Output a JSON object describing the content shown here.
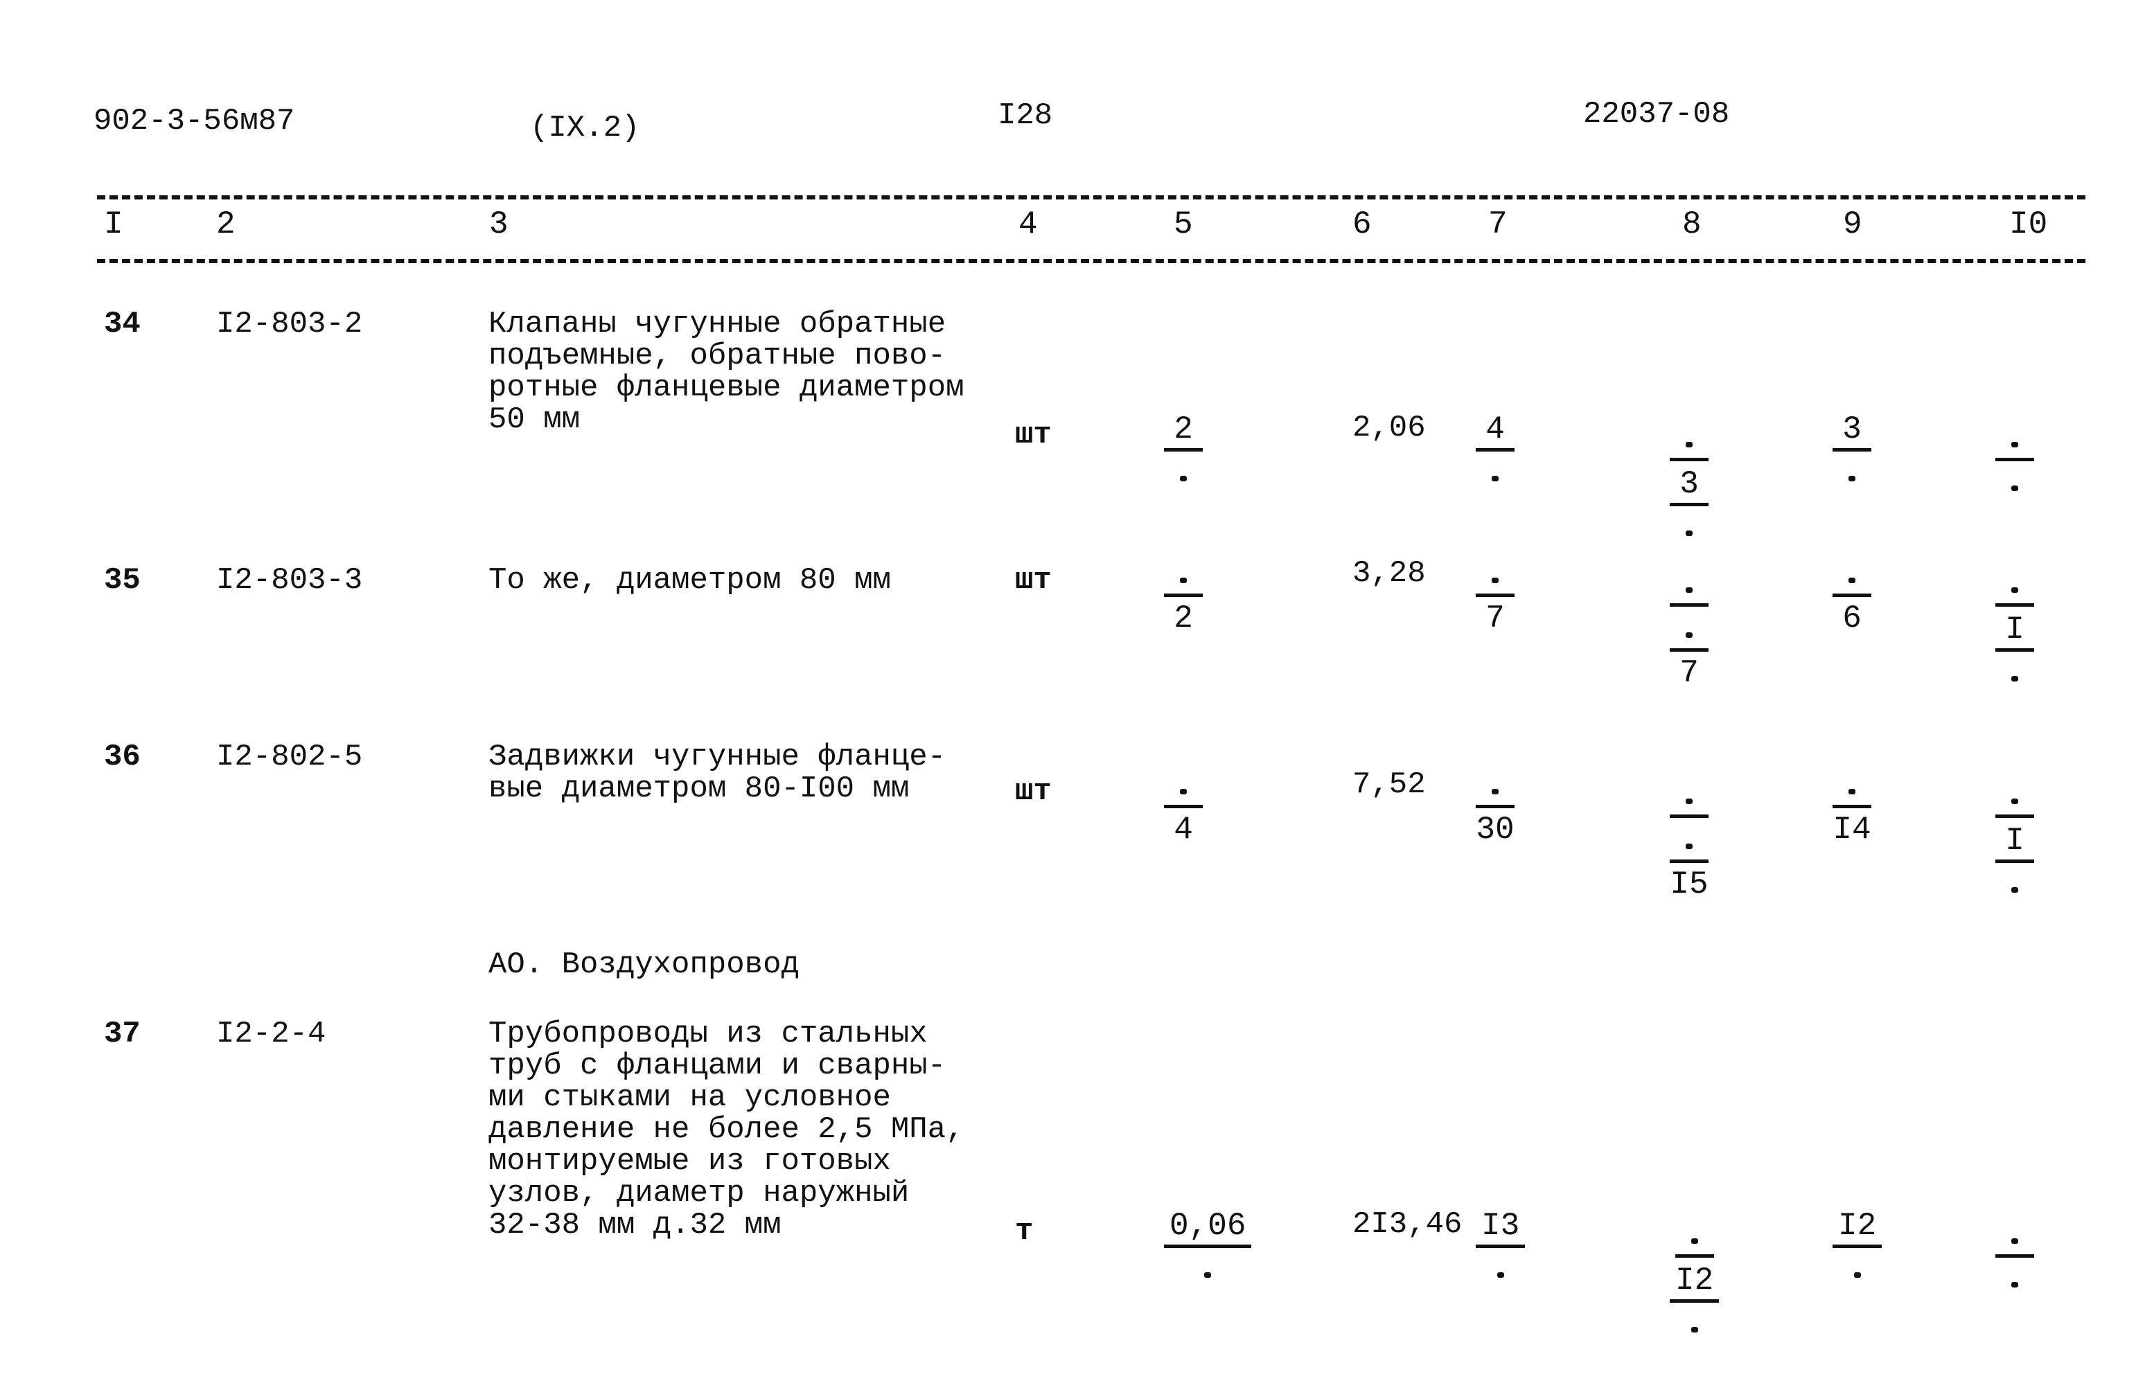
{
  "header": {
    "doc_code": "902-3-56м87",
    "section": "(IX.2)",
    "page": "I28",
    "sheet": "22037-08"
  },
  "columns": [
    "I",
    "2",
    "3",
    "4",
    "5",
    "6",
    "7",
    "8",
    "9",
    "I0"
  ],
  "section_title": "АО. Воздухопровод",
  "rows": [
    {
      "n": "34",
      "code": "I2-803-2",
      "desc": "Клапаны чугунные обратные\nподъемные, обратные пово-\nротные фланцевые диаметром\n50 мм",
      "unit": "шт",
      "c5": {
        "top": "2",
        "bot": "-"
      },
      "c6": "2,06",
      "c7": {
        "top": "4",
        "bot": "-"
      },
      "c8": {
        "top": "-",
        "mid": "3",
        "bot": "-"
      },
      "c9": {
        "top": "3",
        "bot": "-"
      },
      "c10": {
        "top": "-",
        "bot": "-"
      }
    },
    {
      "n": "35",
      "code": "I2-803-3",
      "desc": "То же, диаметром 80 мм",
      "unit": "шт",
      "c5": {
        "top": "-",
        "bot": "2"
      },
      "c6": "3,28",
      "c7": {
        "top": "-",
        "bot": "7"
      },
      "c8": {
        "top": "-",
        "mid": "-",
        "bot": "7"
      },
      "c9": {
        "top": "-",
        "bot": "6"
      },
      "c10": {
        "top": "-",
        "mid": "I",
        "bot": "-"
      }
    },
    {
      "n": "36",
      "code": "I2-802-5",
      "desc": "Задвижки чугунные фланце-\nвые диаметром 80-I00 мм",
      "unit": "шт",
      "c5": {
        "top": "-",
        "bot": "4"
      },
      "c6": "7,52",
      "c7": {
        "top": "-",
        "bot": "30"
      },
      "c8": {
        "top": "-",
        "mid": "-",
        "bot": "I5"
      },
      "c9": {
        "top": "-",
        "bot": "I4"
      },
      "c10": {
        "top": "-",
        "mid": "I",
        "bot": "-"
      }
    },
    {
      "n": "37",
      "code": "I2-2-4",
      "desc": "Трубопроводы из стальных\nтруб с фланцами и сварны-\nми стыками на условное\nдавление не более 2,5 МПа,\nмонтируемые из готовых\nузлов, диаметр наружный\n32-38 мм д.32 мм",
      "unit": "т",
      "c5": {
        "top": "0,06",
        "bot": "-"
      },
      "c6": "2I3,46",
      "c7": {
        "top": "I3",
        "bot": "-"
      },
      "c8": {
        "top": "-",
        "mid": "I2",
        "bot": "-"
      },
      "c9": {
        "top": "I2",
        "bot": "-"
      },
      "c10": {
        "top": "-",
        "bot": "-"
      }
    }
  ]
}
